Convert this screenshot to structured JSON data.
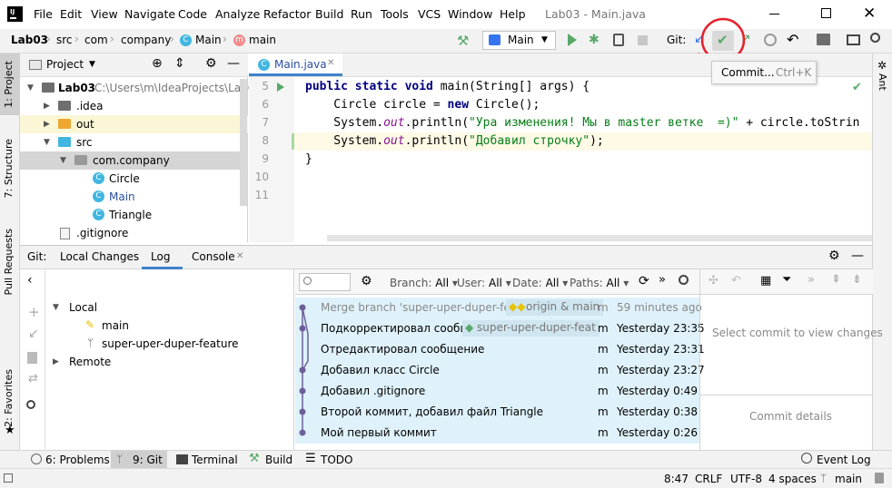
{
  "menu": [
    "File",
    "Edit",
    "View",
    "Navigate",
    "Code",
    "Analyze",
    "Refactor",
    "Build",
    "Run",
    "Tools",
    "VCS",
    "Window",
    "Help"
  ],
  "window_title": "Lab03 - Main.java",
  "breadcrumbs": [
    "Lab03",
    "src",
    "com",
    "company",
    "Main",
    "main"
  ],
  "run_config": "Main",
  "git_label": "Git:",
  "tooltip": {
    "label": "Commit...",
    "shortcut": "Ctrl+K"
  },
  "left_stripe": [
    "1: Project",
    "7: Structure",
    "Pull Requests",
    "2: Favorites"
  ],
  "right_stripe": [
    "Ant"
  ],
  "project": {
    "title": "Project",
    "root": "Lab03",
    "root_path": "C:\\Users\\m\\IdeaProjects\\Lab0",
    "items": [
      ".idea",
      "out",
      "src",
      "com.company",
      "Circle",
      "Main",
      "Triangle",
      ".gitignore"
    ]
  },
  "editor": {
    "tab": "Main.java",
    "lines": [
      "5",
      "6",
      "7",
      "8",
      "9",
      "10",
      "11"
    ],
    "code": {
      "l5_kw": "public static void ",
      "l5_rest": "main(String[] args) {",
      "l6_a": "    Circle circle = ",
      "l6_kw": "new ",
      "l6_b": "Circle();",
      "l7_a": "    System.",
      "l7_out": "out",
      "l7_b": ".println(",
      "l7_str": "\"Ура изменения! Мы в master ветке  =)\"",
      "l7_c": " + circle.toStrin",
      "l8_a": "    System.",
      "l8_out": "out",
      "l8_b": ".println(",
      "l8_str": "\"Добавил строчку\"",
      "l8_c": ");",
      "l9": "}"
    }
  },
  "git_panel": {
    "label": "Git:",
    "tabs": [
      "Local Changes",
      "Log",
      "Console"
    ],
    "active_tab": "Log",
    "tree": {
      "local": "Local",
      "branches": [
        "main",
        "super-uper-duper-feature"
      ],
      "remote": "Remote"
    },
    "filters": {
      "branch": "Branch:",
      "branch_val": "All",
      "user": "User:",
      "user_val": "All",
      "date": "Date:",
      "date_val": "All",
      "paths": "Paths:",
      "paths_val": "All"
    },
    "commits": [
      {
        "msg": "Merge branch 'super-uper-duper-fea",
        "tag": "origin & main",
        "author": "m",
        "time": "59 minutes ago"
      },
      {
        "msg": "Подкорректировал сообще",
        "tag": "super-uper-duper-feat",
        "author": "m",
        "time": "Yesterday 23:35"
      },
      {
        "msg": "Отредактировал сообщение",
        "tag": "",
        "author": "m",
        "time": "Yesterday 23:31"
      },
      {
        "msg": "Добавил класс Circle",
        "tag": "",
        "author": "m",
        "time": "Yesterday 23:27"
      },
      {
        "msg": "Добавил .gitignore",
        "tag": "",
        "author": "m",
        "time": "Yesterday 0:49"
      },
      {
        "msg": "Второй коммит, добавил файл Triangle",
        "tag": "",
        "author": "m",
        "time": "Yesterday 0:38"
      },
      {
        "msg": "Мой первый коммит",
        "tag": "",
        "author": "m",
        "time": "Yesterday 0:26"
      }
    ],
    "select_commit": "Select commit to view changes",
    "commit_details": "Commit details"
  },
  "bottom_tabs": [
    "6: Problems",
    "9: Git",
    "Terminal",
    "Build",
    "TODO"
  ],
  "event_log": "Event Log",
  "status": {
    "pos": "8:47",
    "crlf": "CRLF",
    "enc": "UTF-8",
    "indent": "4 spaces",
    "branch": "main"
  },
  "colors": {
    "accent": "#3574f0",
    "run_green": "#59a869",
    "tag_yellow": "#e6c200",
    "annotation_red": "#e8202a"
  }
}
